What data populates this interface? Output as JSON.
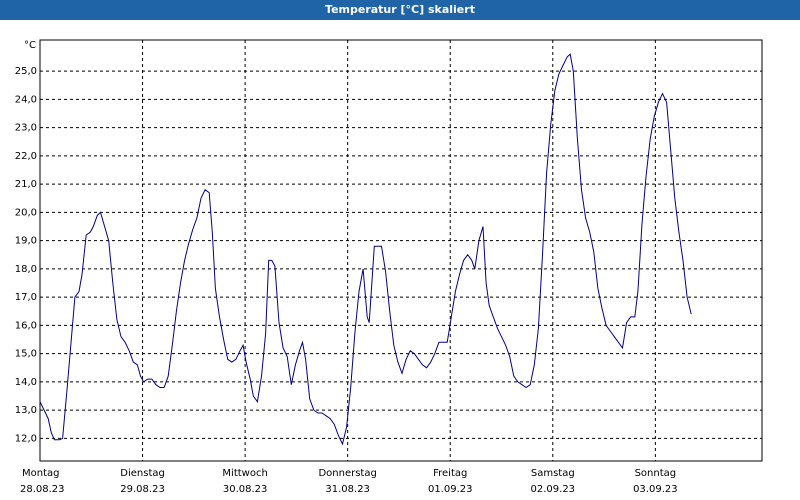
{
  "window": {
    "title": "Temperatur [°C] skaliert"
  },
  "chart_data": {
    "type": "line",
    "title": "Temperatur [°C] skaliert",
    "ylabel": "°C",
    "ylim": [
      11.2,
      26.1
    ],
    "y_ticks": [
      12.0,
      13.0,
      14.0,
      15.0,
      16.0,
      17.0,
      18.0,
      19.0,
      20.0,
      21.0,
      22.0,
      23.0,
      24.0,
      25.0
    ],
    "y_tick_labels": [
      "12,0",
      "13,0",
      "14,0",
      "15,0",
      "16,0",
      "17,0",
      "18,0",
      "19,0",
      "20,0",
      "21,0",
      "22,0",
      "23,0",
      "24,0",
      "25,0"
    ],
    "grid": true,
    "series_color": "#00008b",
    "x_range_days": [
      0,
      7.04
    ],
    "x_ticks": [
      {
        "day": "Montag",
        "date": "28.08.23"
      },
      {
        "day": "Dienstag",
        "date": "29.08.23"
      },
      {
        "day": "Mittwoch",
        "date": "30.08.23"
      },
      {
        "day": "Donnerstag",
        "date": "31.08.23"
      },
      {
        "day": "Freitag",
        "date": "01.09.23"
      },
      {
        "day": "Samstag",
        "date": "02.09.23"
      },
      {
        "day": "Sonntag",
        "date": "03.09.23"
      }
    ],
    "series": [
      {
        "points": [
          [
            0.0,
            13.3
          ],
          [
            0.04,
            13.0
          ],
          [
            0.08,
            12.7
          ],
          [
            0.11,
            12.2
          ],
          [
            0.14,
            11.95
          ],
          [
            0.19,
            11.95
          ],
          [
            0.22,
            12.0
          ],
          [
            0.26,
            13.6
          ],
          [
            0.3,
            15.3
          ],
          [
            0.34,
            17.0
          ],
          [
            0.38,
            17.2
          ],
          [
            0.41,
            17.8
          ],
          [
            0.45,
            19.2
          ],
          [
            0.49,
            19.3
          ],
          [
            0.52,
            19.5
          ],
          [
            0.56,
            19.9
          ],
          [
            0.59,
            20.0
          ],
          [
            0.63,
            19.5
          ],
          [
            0.67,
            19.0
          ],
          [
            0.71,
            17.5
          ],
          [
            0.75,
            16.2
          ],
          [
            0.79,
            15.6
          ],
          [
            0.83,
            15.4
          ],
          [
            0.87,
            15.1
          ],
          [
            0.91,
            14.7
          ],
          [
            0.95,
            14.6
          ],
          [
            0.98,
            14.2
          ],
          [
            1.01,
            14.0
          ],
          [
            1.05,
            14.1
          ],
          [
            1.09,
            14.1
          ],
          [
            1.13,
            13.9
          ],
          [
            1.17,
            13.8
          ],
          [
            1.21,
            13.8
          ],
          [
            1.25,
            14.2
          ],
          [
            1.29,
            15.3
          ],
          [
            1.33,
            16.5
          ],
          [
            1.37,
            17.5
          ],
          [
            1.41,
            18.3
          ],
          [
            1.45,
            18.9
          ],
          [
            1.49,
            19.4
          ],
          [
            1.53,
            19.8
          ],
          [
            1.57,
            20.5
          ],
          [
            1.61,
            20.8
          ],
          [
            1.65,
            20.7
          ],
          [
            1.68,
            19.3
          ],
          [
            1.71,
            17.3
          ],
          [
            1.75,
            16.3
          ],
          [
            1.79,
            15.5
          ],
          [
            1.83,
            14.8
          ],
          [
            1.87,
            14.7
          ],
          [
            1.91,
            14.8
          ],
          [
            1.95,
            15.1
          ],
          [
            1.98,
            15.3
          ],
          [
            2.01,
            14.7
          ],
          [
            2.05,
            14.1
          ],
          [
            2.08,
            13.5
          ],
          [
            2.12,
            13.3
          ],
          [
            2.16,
            14.2
          ],
          [
            2.2,
            15.7
          ],
          [
            2.23,
            18.3
          ],
          [
            2.26,
            18.3
          ],
          [
            2.29,
            18.1
          ],
          [
            2.33,
            16.1
          ],
          [
            2.37,
            15.2
          ],
          [
            2.41,
            14.9
          ],
          [
            2.45,
            13.9
          ],
          [
            2.49,
            14.6
          ],
          [
            2.53,
            15.1
          ],
          [
            2.56,
            15.4
          ],
          [
            2.59,
            14.8
          ],
          [
            2.63,
            13.4
          ],
          [
            2.67,
            13.0
          ],
          [
            2.71,
            12.9
          ],
          [
            2.75,
            12.9
          ],
          [
            2.79,
            12.8
          ],
          [
            2.83,
            12.7
          ],
          [
            2.87,
            12.5
          ],
          [
            2.91,
            12.1
          ],
          [
            2.95,
            11.8
          ],
          [
            2.99,
            12.4
          ],
          [
            3.03,
            13.8
          ],
          [
            3.07,
            15.7
          ],
          [
            3.11,
            17.2
          ],
          [
            3.15,
            18.0
          ],
          [
            3.19,
            16.3
          ],
          [
            3.21,
            16.1
          ],
          [
            3.23,
            17.2
          ],
          [
            3.26,
            18.8
          ],
          [
            3.3,
            18.8
          ],
          [
            3.33,
            18.8
          ],
          [
            3.37,
            17.9
          ],
          [
            3.41,
            16.5
          ],
          [
            3.45,
            15.3
          ],
          [
            3.49,
            14.7
          ],
          [
            3.53,
            14.3
          ],
          [
            3.57,
            14.8
          ],
          [
            3.61,
            15.1
          ],
          [
            3.65,
            15.0
          ],
          [
            3.69,
            14.8
          ],
          [
            3.73,
            14.6
          ],
          [
            3.77,
            14.5
          ],
          [
            3.81,
            14.7
          ],
          [
            3.85,
            15.0
          ],
          [
            3.89,
            15.4
          ],
          [
            3.93,
            15.4
          ],
          [
            3.97,
            15.4
          ],
          [
            4.01,
            16.3
          ],
          [
            4.05,
            17.2
          ],
          [
            4.09,
            17.8
          ],
          [
            4.13,
            18.3
          ],
          [
            4.17,
            18.5
          ],
          [
            4.21,
            18.3
          ],
          [
            4.24,
            18.0
          ],
          [
            4.28,
            19.0
          ],
          [
            4.32,
            19.5
          ],
          [
            4.35,
            17.5
          ],
          [
            4.38,
            16.7
          ],
          [
            4.42,
            16.3
          ],
          [
            4.46,
            15.9
          ],
          [
            4.5,
            15.6
          ],
          [
            4.54,
            15.3
          ],
          [
            4.58,
            14.9
          ],
          [
            4.62,
            14.2
          ],
          [
            4.66,
            14.0
          ],
          [
            4.7,
            13.9
          ],
          [
            4.74,
            13.8
          ],
          [
            4.78,
            13.9
          ],
          [
            4.82,
            14.6
          ],
          [
            4.86,
            15.9
          ],
          [
            4.9,
            18.5
          ],
          [
            4.94,
            21.4
          ],
          [
            4.98,
            23.1
          ],
          [
            5.02,
            24.3
          ],
          [
            5.06,
            24.9
          ],
          [
            5.1,
            25.2
          ],
          [
            5.14,
            25.5
          ],
          [
            5.17,
            25.6
          ],
          [
            5.2,
            25.0
          ],
          [
            5.24,
            22.6
          ],
          [
            5.28,
            20.8
          ],
          [
            5.32,
            19.8
          ],
          [
            5.36,
            19.3
          ],
          [
            5.4,
            18.6
          ],
          [
            5.44,
            17.3
          ],
          [
            5.48,
            16.6
          ],
          [
            5.52,
            16.0
          ],
          [
            5.56,
            15.8
          ],
          [
            5.6,
            15.6
          ],
          [
            5.64,
            15.4
          ],
          [
            5.68,
            15.2
          ],
          [
            5.72,
            16.1
          ],
          [
            5.76,
            16.3
          ],
          [
            5.8,
            16.3
          ],
          [
            5.83,
            17.2
          ],
          [
            5.87,
            19.6
          ],
          [
            5.91,
            21.3
          ],
          [
            5.95,
            22.6
          ],
          [
            5.99,
            23.4
          ],
          [
            6.03,
            23.9
          ],
          [
            6.07,
            24.2
          ],
          [
            6.11,
            23.9
          ],
          [
            6.15,
            22.2
          ],
          [
            6.19,
            20.5
          ],
          [
            6.23,
            19.3
          ],
          [
            6.27,
            18.3
          ],
          [
            6.31,
            17.0
          ],
          [
            6.35,
            16.4
          ]
        ]
      }
    ]
  }
}
